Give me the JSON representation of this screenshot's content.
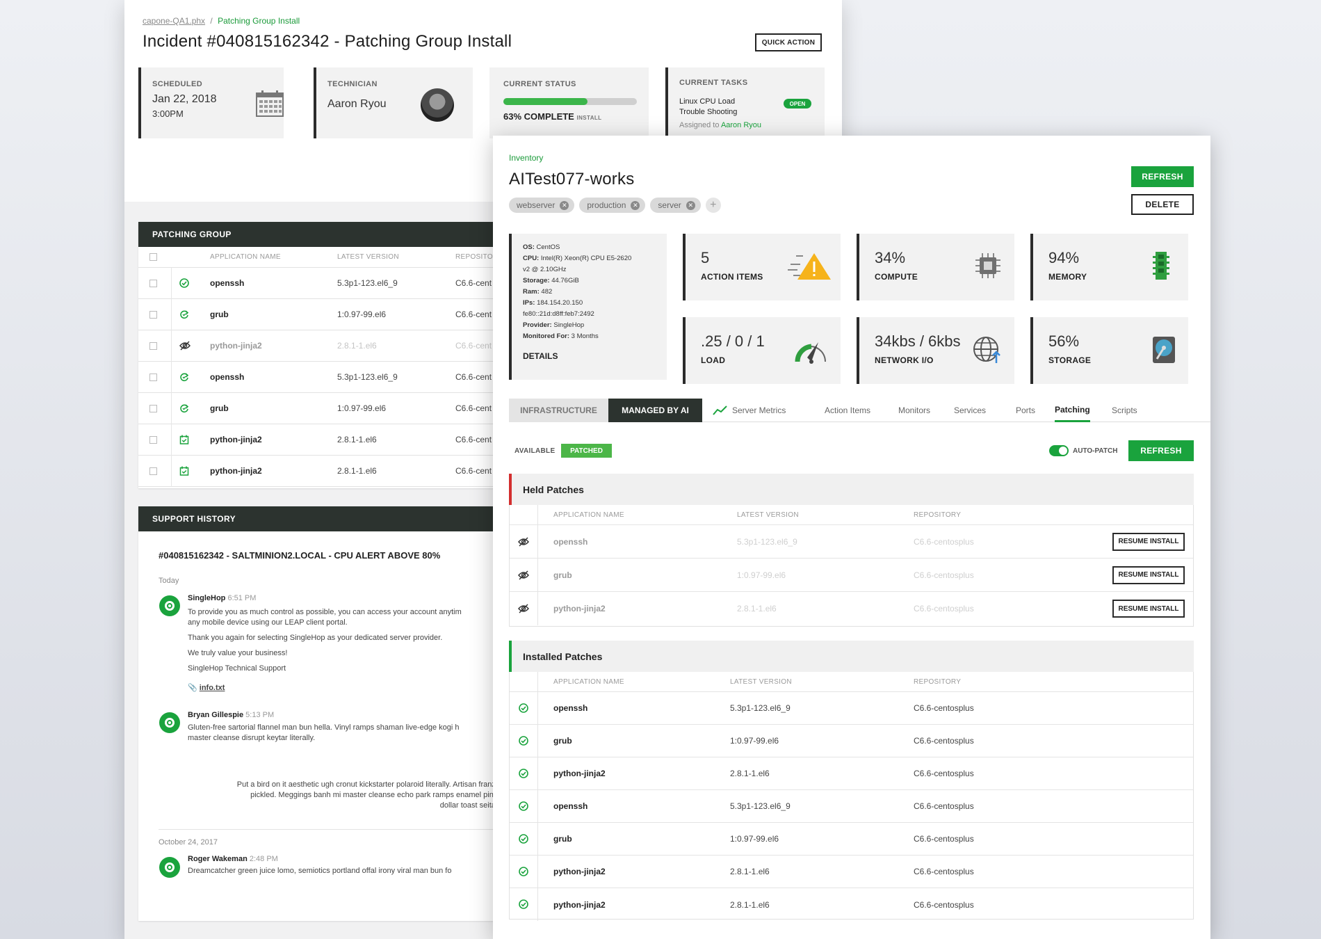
{
  "incident": {
    "breadcrumb": {
      "host": "capone-QA1.phx",
      "sep": "/",
      "current": "Patching Group Install"
    },
    "title": "Incident #040815162342 - Patching Group Install",
    "quick_action": "QUICK ACTION",
    "scheduled": {
      "label": "SCHEDULED",
      "date": "Jan 22, 2018",
      "time": "3:00PM"
    },
    "technician": {
      "label": "TECHNICIAN",
      "name": "Aaron Ryou"
    },
    "status": {
      "label": "CURRENT STATUS",
      "value": "63% COMPLETE",
      "sub": "INSTALL",
      "progress": 0.63
    },
    "tasks": {
      "label": "CURRENT TASKS",
      "line1": "Linux CPU Load",
      "line2": "Trouble Shooting",
      "badge": "OPEN",
      "assigned_prefix": "Assigned to",
      "assigned_name": "Aaron Ryou"
    },
    "patching_group": {
      "header": "PATCHING GROUP",
      "columns": [
        "APPLICATION NAME",
        "LATEST VERSION",
        "REPOSITOR"
      ],
      "rows": [
        {
          "icon": "check-circle-icon",
          "name": "openssh",
          "version": "5.3p1-123.el6_9",
          "repo": "C6.6-cent"
        },
        {
          "icon": "refresh-icon",
          "name": "grub",
          "version": "1:0.97-99.el6",
          "repo": "C6.6-cent"
        },
        {
          "icon": "eye-slash-icon",
          "name": "python-jinja2",
          "version": "2.8.1-1.el6",
          "repo": "C6.6-cent"
        },
        {
          "icon": "refresh-icon",
          "name": "openssh",
          "version": "5.3p1-123.el6_9",
          "repo": "C6.6-cent"
        },
        {
          "icon": "refresh-icon",
          "name": "grub",
          "version": "1:0.97-99.el6",
          "repo": "C6.6-cent"
        },
        {
          "icon": "calendar-check-icon",
          "name": "python-jinja2",
          "version": "2.8.1-1.el6",
          "repo": "C6.6-cent"
        },
        {
          "icon": "calendar-check-icon",
          "name": "python-jinja2",
          "version": "2.8.1-1.el6",
          "repo": "C6.6-cent"
        }
      ]
    },
    "support": {
      "header": "SUPPORT HISTORY",
      "ticket": "#040815162342 - SALTMINION2.LOCAL - CPU ALERT ABOVE 80%",
      "today": "Today",
      "msg1": {
        "author": "SingleHop",
        "time": "6:51 PM",
        "p1a": "To provide you as much control as possible, you can access your account anytim",
        "p1b": "any mobile device using our LEAP client portal.",
        "p2": "Thank you again for selecting SingleHop as your dedicated server provider.",
        "p3": "We truly value your business!",
        "p4": "SingleHop Technical Support",
        "attachment": "info.txt"
      },
      "msg2": {
        "author": "Bryan Gillespie",
        "time": "5:13 PM",
        "p1a": "Gluten-free sartorial flannel man bun hella. Vinyl ramps shaman live-edge kogi h",
        "p1b": "master cleanse disrupt keytar literally.",
        "q1": "Put a bird on it aesthetic ugh cronut kickstarter polaroid literally. Artisan franze",
        "q2": "pickled. Meggings banh mi master cleanse echo park ramps enamel pin p",
        "q3": "dollar toast seitan"
      },
      "date2": "October 24, 2017",
      "msg3": {
        "author": "Roger Wakeman",
        "time": "2:48 PM",
        "p1": "Dreamcatcher green juice lomo, semiotics portland offal irony viral man bun fo"
      }
    }
  },
  "inventory": {
    "breadcrumb": "Inventory",
    "title": "AITest077-works",
    "refresh": "REFRESH",
    "delete": "DELETE",
    "tags": [
      "webserver",
      "production",
      "server"
    ],
    "details": {
      "os_label": "OS:",
      "os": "CentOS",
      "cpu_label": "CPU:",
      "cpu1": "Intel(R) Xeon(R) CPU E5-2620",
      "cpu2": "v2 @ 2.10GHz",
      "storage_label": "Storage:",
      "storage": "44.76GiB",
      "ram_label": "Ram:",
      "ram": "482",
      "ips_label": "IPs:",
      "ips1": "184.154.20.150",
      "ips2": "fe80::21d:d8ff:feb7:2492",
      "provider_label": "Provider:",
      "provider": "SingleHop",
      "monitored_label": "Monitored For:",
      "monitored": "3 Months",
      "link": "DETAILS"
    },
    "stats": [
      {
        "value": "5",
        "label": "ACTION ITEMS",
        "icon": "warning-icon"
      },
      {
        "value": "34%",
        "label": "COMPUTE",
        "icon": "cpu-chip-icon"
      },
      {
        "value": "94%",
        "label": "MEMORY",
        "icon": "memory-icon"
      },
      {
        "value": ".25 / 0 / 1",
        "label": "LOAD",
        "icon": "gauge-icon"
      },
      {
        "value": "34kbs / 6kbs",
        "label": "NETWORK I/O",
        "icon": "globe-icon"
      },
      {
        "value": "56%",
        "label": "STORAGE",
        "icon": "hard-drive-icon"
      }
    ],
    "tabs": {
      "infra": "INFRASTRUCTURE",
      "managed": "MANAGED BY AI",
      "metrics": "Server Metrics",
      "actions": "Action Items",
      "monitors": "Monitors",
      "services": "Services",
      "ports": "Ports",
      "patching": "Patching",
      "scripts": "Scripts"
    },
    "filter": {
      "available": "AVAILABLE",
      "patched": "PATCHED",
      "autopatch": "AUTO-PATCH",
      "refresh": "REFRESH"
    },
    "held": {
      "title": "Held Patches",
      "columns": [
        "APPLICATION NAME",
        "LATEST VERSION",
        "REPOSITORY"
      ],
      "action": "RESUME INSTALL",
      "rows": [
        {
          "name": "openssh",
          "version": "5.3p1-123.el6_9",
          "repo": "C6.6-centosplus"
        },
        {
          "name": "grub",
          "version": "1:0.97-99.el6",
          "repo": "C6.6-centosplus"
        },
        {
          "name": "python-jinja2",
          "version": "2.8.1-1.el6",
          "repo": "C6.6-centosplus"
        }
      ]
    },
    "installed": {
      "title": "Installed Patches",
      "columns": [
        "APPLICATION NAME",
        "LATEST VERSION",
        "REPOSITORY"
      ],
      "rows": [
        {
          "name": "openssh",
          "version": "5.3p1-123.el6_9",
          "repo": "C6.6-centosplus"
        },
        {
          "name": "grub",
          "version": "1:0.97-99.el6",
          "repo": "C6.6-centosplus"
        },
        {
          "name": "python-jinja2",
          "version": "2.8.1-1.el6",
          "repo": "C6.6-centosplus"
        },
        {
          "name": "openssh",
          "version": "5.3p1-123.el6_9",
          "repo": "C6.6-centosplus"
        },
        {
          "name": "grub",
          "version": "1:0.97-99.el6",
          "repo": "C6.6-centosplus"
        },
        {
          "name": "python-jinja2",
          "version": "2.8.1-1.el6",
          "repo": "C6.6-centosplus"
        },
        {
          "name": "python-jinja2",
          "version": "2.8.1-1.el6",
          "repo": "C6.6-centosplus"
        }
      ]
    }
  },
  "colors": {
    "accent": "#1aa33d",
    "dark": "#2c332f",
    "held_bar": "#d32f2f"
  }
}
